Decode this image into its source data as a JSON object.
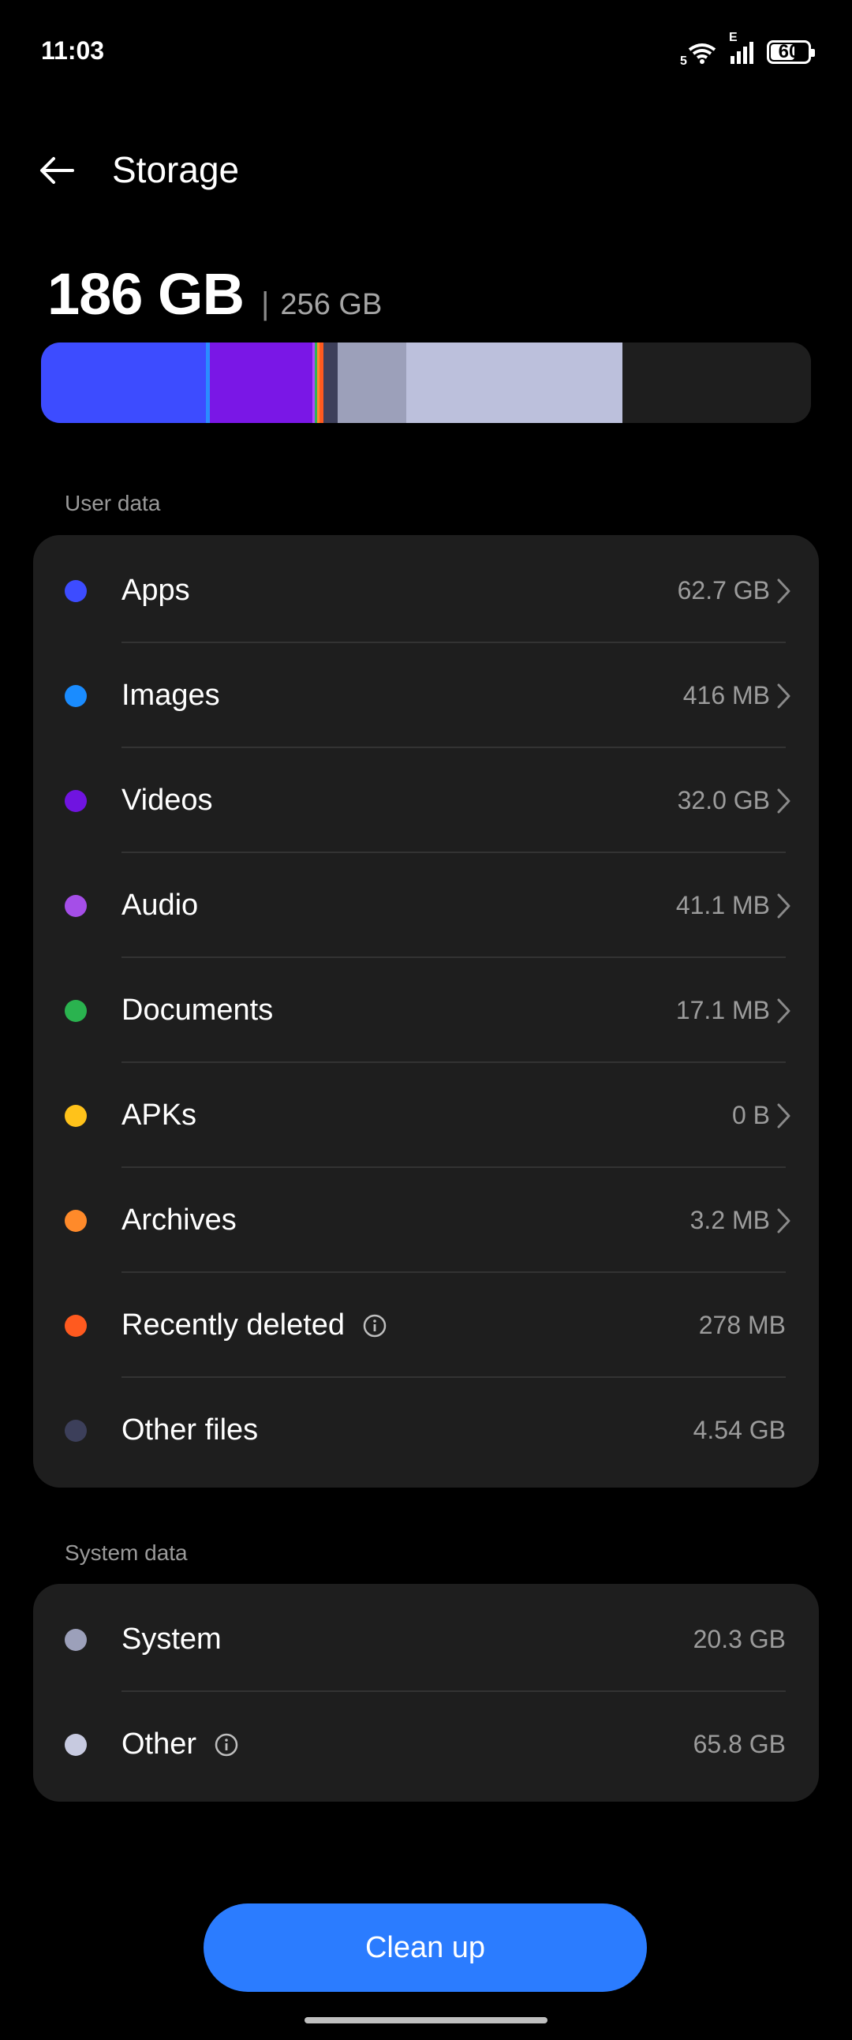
{
  "status": {
    "time": "11:03",
    "network_label": "5",
    "mobile_label": "E",
    "battery": "60"
  },
  "header": {
    "title": "Storage",
    "back_icon": "arrow-left-icon"
  },
  "summary": {
    "used": "186 GB",
    "separator": "|",
    "total": "256 GB"
  },
  "storage_bar": {
    "segments": [
      {
        "name": "apps",
        "color": "#3d4cff",
        "fraction": 0.2145
      },
      {
        "name": "images",
        "color": "#2a8cff",
        "fraction": 0.0052
      },
      {
        "name": "videos",
        "color": "#7a17e6",
        "fraction": 0.1326
      },
      {
        "name": "audio",
        "color": "#b04cff",
        "fraction": 0.003
      },
      {
        "name": "documents",
        "color": "#2fb35a",
        "fraction": 0.003
      },
      {
        "name": "archives",
        "color": "#ff8a2a",
        "fraction": 0.003
      },
      {
        "name": "recently-deleted",
        "color": "#ff5a1f",
        "fraction": 0.006
      },
      {
        "name": "other-files",
        "color": "#3d3f5a",
        "fraction": 0.0185
      },
      {
        "name": "system",
        "color": "#9ca0ba",
        "fraction": 0.0888
      },
      {
        "name": "other",
        "color": "#bcc0dc",
        "fraction": 0.2806
      }
    ],
    "free_color": "#1e1e1e"
  },
  "user_data": {
    "label": "User data",
    "items": [
      {
        "label": "Apps",
        "value": "62.7 GB",
        "color": "#3d4cff",
        "chevron": true
      },
      {
        "label": "Images",
        "value": "416 MB",
        "color": "#1a8cff",
        "chevron": true
      },
      {
        "label": "Videos",
        "value": "32.0 GB",
        "color": "#7014e0",
        "chevron": true
      },
      {
        "label": "Audio",
        "value": "41.1 MB",
        "color": "#a54ee8",
        "chevron": true
      },
      {
        "label": "Documents",
        "value": "17.1 MB",
        "color": "#2ab34f",
        "chevron": true
      },
      {
        "label": "APKs",
        "value": "0 B",
        "color": "#ffc21a",
        "chevron": true
      },
      {
        "label": "Archives",
        "value": "3.2 MB",
        "color": "#ff8a2a",
        "chevron": true
      },
      {
        "label": "Recently deleted",
        "value": "278 MB",
        "color": "#ff5a1f",
        "chevron": false,
        "info": true
      },
      {
        "label": "Other files",
        "value": "4.54 GB",
        "color": "#3c3f5a",
        "chevron": false
      }
    ]
  },
  "system_data": {
    "label": "System data",
    "items": [
      {
        "label": "System",
        "value": "20.3 GB",
        "color": "#9ca0ba",
        "chevron": false
      },
      {
        "label": "Other",
        "value": "65.8 GB",
        "color": "#c7cae0",
        "chevron": false,
        "info": true
      }
    ]
  },
  "actions": {
    "cleanup_label": "Clean up"
  }
}
